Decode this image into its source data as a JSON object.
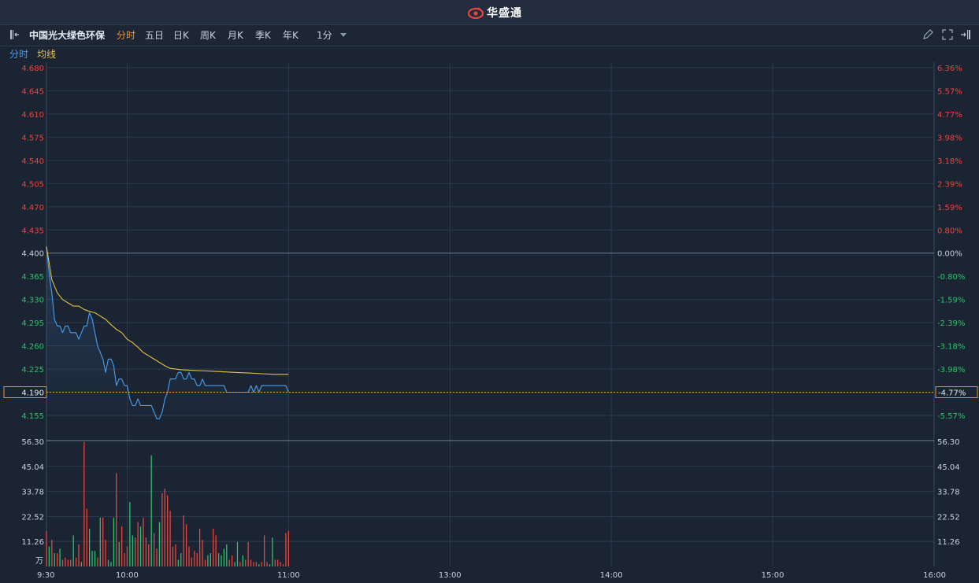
{
  "app": {
    "name": "华盛通"
  },
  "toolbar": {
    "stock_name": "中国光大绿色环保",
    "periods": [
      "分时",
      "五日",
      "日K",
      "周K",
      "月K",
      "季K",
      "年K"
    ],
    "active_period": "分时",
    "interval": "1分"
  },
  "legend": {
    "items": [
      "分时",
      "均线"
    ]
  },
  "colors": {
    "background": "#1b2433",
    "price_line": "#4a9fef",
    "avg_line": "#e2c146",
    "up": "#e8453c",
    "down": "#2fc06d",
    "accent_orange": "#f0932b",
    "grid": "#2c3a4e"
  },
  "current": {
    "price_label": "4.190",
    "pct_label": "-4.77%"
  },
  "chart_data": [
    {
      "type": "line",
      "title": "",
      "y_ticks_left": [
        "4.680",
        "4.645",
        "4.610",
        "4.575",
        "4.540",
        "4.505",
        "4.470",
        "4.435",
        "4.400",
        "4.365",
        "4.330",
        "4.295",
        "4.260",
        "4.225",
        "4.190",
        "4.155"
      ],
      "y_ticks_right": [
        "6.36%",
        "5.57%",
        "4.77%",
        "3.98%",
        "3.18%",
        "2.39%",
        "1.59%",
        "0.80%",
        "0.00%",
        "-0.80%",
        "-1.59%",
        "-2.39%",
        "-3.18%",
        "-3.98%",
        "-4.77%",
        "-5.57%"
      ],
      "prev_close": 4.4,
      "ylim": [
        4.12,
        4.68
      ],
      "x_ticks": [
        "9:30",
        "10:00",
        "11:00",
        "13:00",
        "14:00",
        "15:00",
        "16:00"
      ],
      "x_minutes": [
        0,
        30,
        90,
        150,
        210,
        270,
        330
      ],
      "xlim_minutes": [
        0,
        330
      ],
      "series": [
        {
          "name": "分时",
          "points": [
            [
              0,
              4.41
            ],
            [
              1,
              4.37
            ],
            [
              2,
              4.34
            ],
            [
              3,
              4.3
            ],
            [
              4,
              4.29
            ],
            [
              5,
              4.29
            ],
            [
              6,
              4.28
            ],
            [
              7,
              4.29
            ],
            [
              8,
              4.29
            ],
            [
              9,
              4.28
            ],
            [
              10,
              4.28
            ],
            [
              11,
              4.28
            ],
            [
              12,
              4.27
            ],
            [
              13,
              4.28
            ],
            [
              14,
              4.29
            ],
            [
              15,
              4.29
            ],
            [
              16,
              4.31
            ],
            [
              17,
              4.3
            ],
            [
              18,
              4.28
            ],
            [
              19,
              4.26
            ],
            [
              20,
              4.25
            ],
            [
              21,
              4.24
            ],
            [
              22,
              4.22
            ],
            [
              23,
              4.24
            ],
            [
              24,
              4.24
            ],
            [
              25,
              4.23
            ],
            [
              26,
              4.2
            ],
            [
              27,
              4.21
            ],
            [
              28,
              4.21
            ],
            [
              29,
              4.2
            ],
            [
              30,
              4.2
            ],
            [
              31,
              4.18
            ],
            [
              32,
              4.17
            ],
            [
              33,
              4.17
            ],
            [
              34,
              4.18
            ],
            [
              35,
              4.17
            ],
            [
              36,
              4.17
            ],
            [
              37,
              4.17
            ],
            [
              38,
              4.17
            ],
            [
              39,
              4.17
            ],
            [
              40,
              4.16
            ],
            [
              41,
              4.15
            ],
            [
              42,
              4.15
            ],
            [
              43,
              4.16
            ],
            [
              44,
              4.18
            ],
            [
              45,
              4.19
            ],
            [
              46,
              4.21
            ],
            [
              47,
              4.21
            ],
            [
              48,
              4.21
            ],
            [
              49,
              4.22
            ],
            [
              50,
              4.22
            ],
            [
              51,
              4.21
            ],
            [
              52,
              4.21
            ],
            [
              53,
              4.22
            ],
            [
              54,
              4.21
            ],
            [
              55,
              4.21
            ],
            [
              56,
              4.2
            ],
            [
              57,
              4.2
            ],
            [
              58,
              4.21
            ],
            [
              59,
              4.2
            ],
            [
              60,
              4.2
            ],
            [
              61,
              4.2
            ],
            [
              62,
              4.2
            ],
            [
              63,
              4.2
            ],
            [
              64,
              4.2
            ],
            [
              65,
              4.2
            ],
            [
              66,
              4.2
            ],
            [
              67,
              4.19
            ],
            [
              68,
              4.19
            ],
            [
              69,
              4.19
            ],
            [
              70,
              4.19
            ],
            [
              71,
              4.19
            ],
            [
              72,
              4.19
            ],
            [
              73,
              4.19
            ],
            [
              74,
              4.19
            ],
            [
              75,
              4.19
            ],
            [
              76,
              4.2
            ],
            [
              77,
              4.19
            ],
            [
              78,
              4.2
            ],
            [
              79,
              4.19
            ],
            [
              80,
              4.2
            ],
            [
              81,
              4.2
            ],
            [
              82,
              4.2
            ],
            [
              83,
              4.2
            ],
            [
              84,
              4.2
            ],
            [
              85,
              4.2
            ],
            [
              86,
              4.2
            ],
            [
              87,
              4.2
            ],
            [
              88,
              4.2
            ],
            [
              89,
              4.2
            ],
            [
              90,
              4.19
            ]
          ]
        },
        {
          "name": "均线",
          "points": [
            [
              0,
              4.41
            ],
            [
              2,
              4.36
            ],
            [
              4,
              4.34
            ],
            [
              6,
              4.33
            ],
            [
              8,
              4.325
            ],
            [
              10,
              4.32
            ],
            [
              12,
              4.32
            ],
            [
              14,
              4.315
            ],
            [
              16,
              4.312
            ],
            [
              18,
              4.31
            ],
            [
              20,
              4.305
            ],
            [
              22,
              4.3
            ],
            [
              24,
              4.292
            ],
            [
              26,
              4.285
            ],
            [
              28,
              4.28
            ],
            [
              30,
              4.27
            ],
            [
              32,
              4.265
            ],
            [
              34,
              4.258
            ],
            [
              36,
              4.25
            ],
            [
              38,
              4.245
            ],
            [
              40,
              4.24
            ],
            [
              42,
              4.235
            ],
            [
              44,
              4.23
            ],
            [
              46,
              4.226
            ],
            [
              48,
              4.225
            ],
            [
              50,
              4.224
            ],
            [
              55,
              4.223
            ],
            [
              60,
              4.222
            ],
            [
              65,
              4.221
            ],
            [
              70,
              4.22
            ],
            [
              75,
              4.219
            ],
            [
              80,
              4.218
            ],
            [
              85,
              4.217
            ],
            [
              90,
              4.217
            ]
          ]
        }
      ]
    },
    {
      "type": "bar",
      "title": "",
      "unit_label": "万",
      "y_ticks": [
        "56.30",
        "45.04",
        "33.78",
        "22.52",
        "11.26"
      ],
      "ylim": [
        0,
        56.3
      ],
      "colors_by_direction": true,
      "bars": [
        [
          0,
          16,
          "up"
        ],
        [
          1,
          9,
          "down"
        ],
        [
          2,
          12,
          "up"
        ],
        [
          3,
          6,
          "down"
        ],
        [
          4,
          6,
          "up"
        ],
        [
          5,
          8,
          "down"
        ],
        [
          6,
          3,
          "up"
        ],
        [
          7,
          4,
          "up"
        ],
        [
          8,
          3,
          "up"
        ],
        [
          9,
          3,
          "up"
        ],
        [
          10,
          14,
          "down"
        ],
        [
          11,
          4,
          "up"
        ],
        [
          12,
          10,
          "up"
        ],
        [
          13,
          2,
          "down"
        ],
        [
          14,
          56,
          "up"
        ],
        [
          15,
          26,
          "up"
        ],
        [
          16,
          17,
          "down"
        ],
        [
          17,
          7,
          "down"
        ],
        [
          18,
          7,
          "down"
        ],
        [
          19,
          4,
          "up"
        ],
        [
          20,
          22,
          "down"
        ],
        [
          21,
          22,
          "up"
        ],
        [
          22,
          12,
          "up"
        ],
        [
          23,
          3,
          "down"
        ],
        [
          24,
          2,
          "down"
        ],
        [
          25,
          22,
          "down"
        ],
        [
          26,
          42,
          "up"
        ],
        [
          27,
          11,
          "down"
        ],
        [
          28,
          18,
          "up"
        ],
        [
          29,
          6,
          "up"
        ],
        [
          30,
          9,
          "up"
        ],
        [
          31,
          29,
          "down"
        ],
        [
          32,
          14,
          "down"
        ],
        [
          33,
          13,
          "up"
        ],
        [
          34,
          20,
          "up"
        ],
        [
          35,
          18,
          "down"
        ],
        [
          36,
          22,
          "up"
        ],
        [
          37,
          13,
          "up"
        ],
        [
          38,
          10,
          "up"
        ],
        [
          39,
          50,
          "down"
        ],
        [
          40,
          15,
          "up"
        ],
        [
          41,
          8,
          "up"
        ],
        [
          42,
          20,
          "down"
        ],
        [
          43,
          33,
          "up"
        ],
        [
          44,
          35,
          "up"
        ],
        [
          45,
          32,
          "up"
        ],
        [
          46,
          25,
          "up"
        ],
        [
          47,
          9,
          "up"
        ],
        [
          48,
          10,
          "up"
        ],
        [
          49,
          3,
          "down"
        ],
        [
          50,
          6,
          "down"
        ],
        [
          51,
          23,
          "up"
        ],
        [
          52,
          19,
          "up"
        ],
        [
          53,
          9,
          "up"
        ],
        [
          54,
          4,
          "up"
        ],
        [
          55,
          7,
          "up"
        ],
        [
          56,
          6,
          "up"
        ],
        [
          57,
          17,
          "up"
        ],
        [
          58,
          12,
          "up"
        ],
        [
          59,
          3,
          "up"
        ],
        [
          60,
          5,
          "down"
        ],
        [
          61,
          6,
          "down"
        ],
        [
          62,
          17,
          "up"
        ],
        [
          63,
          14,
          "up"
        ],
        [
          64,
          6,
          "down"
        ],
        [
          65,
          5,
          "down"
        ],
        [
          66,
          8,
          "down"
        ],
        [
          67,
          10,
          "down"
        ],
        [
          68,
          3,
          "up"
        ],
        [
          69,
          5,
          "up"
        ],
        [
          70,
          2,
          "down"
        ],
        [
          71,
          11,
          "down"
        ],
        [
          72,
          2,
          "up"
        ],
        [
          73,
          5,
          "down"
        ],
        [
          74,
          3,
          "up"
        ],
        [
          75,
          11,
          "up"
        ],
        [
          76,
          3,
          "up"
        ],
        [
          77,
          2,
          "up"
        ],
        [
          78,
          2,
          "up"
        ],
        [
          79,
          1,
          "down"
        ],
        [
          80,
          2,
          "up"
        ],
        [
          81,
          14,
          "up"
        ],
        [
          82,
          2,
          "up"
        ],
        [
          83,
          1,
          "down"
        ],
        [
          84,
          13,
          "down"
        ],
        [
          85,
          3,
          "up"
        ],
        [
          86,
          3,
          "up"
        ],
        [
          87,
          2,
          "up"
        ],
        [
          88,
          1,
          "up"
        ],
        [
          89,
          15,
          "up"
        ],
        [
          90,
          16,
          "up"
        ]
      ]
    }
  ]
}
